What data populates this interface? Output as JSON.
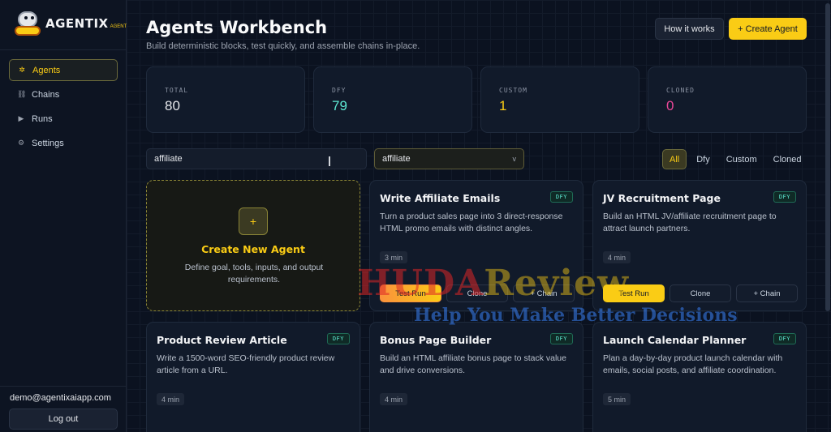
{
  "sidebar": {
    "logo_text": "AGENTIX",
    "logo_sub": "AGENTS",
    "items": [
      {
        "label": "Agents",
        "icon": "✲"
      },
      {
        "label": "Chains",
        "icon": "⛓"
      },
      {
        "label": "Runs",
        "icon": "▶"
      },
      {
        "label": "Settings",
        "icon": "⚙"
      }
    ],
    "email": "demo@agentixaiapp.com",
    "logout": "Log out"
  },
  "header": {
    "title": "Agents Workbench",
    "subtitle": "Build deterministic blocks, test quickly, and assemble chains in-place.",
    "how_label": "How it works",
    "create_label": "+ Create Agent"
  },
  "stats": [
    {
      "label": "TOTAL",
      "value": "80",
      "color": "#e5e7eb"
    },
    {
      "label": "DFY",
      "value": "79",
      "color": "#5eead4"
    },
    {
      "label": "CUSTOM",
      "value": "1",
      "color": "#facc15"
    },
    {
      "label": "CLONED",
      "value": "0",
      "color": "#ec4899"
    }
  ],
  "search": {
    "value": "affiliate"
  },
  "category_select": {
    "value": "affiliate",
    "caret": "v"
  },
  "filters": [
    "All",
    "Dfy",
    "Custom",
    "Cloned"
  ],
  "create_card": {
    "plus": "+",
    "title": "Create New Agent",
    "desc": "Define goal, tools, inputs, and output requirements."
  },
  "cards": [
    {
      "title": "Write Affiliate Emails",
      "badge": "DFY",
      "desc": "Turn a product sales page into 3 direct-response HTML promo emails with distinct angles.",
      "time": "3 min",
      "test": "Test Run",
      "clone": "Clone",
      "chain": "+ Chain"
    },
    {
      "title": "JV Recruitment Page",
      "badge": "DFY",
      "desc": "Build an HTML JV/affiliate recruitment page to attract launch partners.",
      "time": "4 min",
      "test": "Test Run",
      "clone": "Clone",
      "chain": "+ Chain"
    },
    {
      "title": "Product Review Article",
      "badge": "DFY",
      "desc": "Write a 1500-word SEO-friendly product review article from a URL.",
      "time": "4 min"
    },
    {
      "title": "Bonus Page Builder",
      "badge": "DFY",
      "desc": "Build an HTML affiliate bonus page to stack value and drive conversions.",
      "time": "4 min"
    },
    {
      "title": "Launch Calendar Planner",
      "badge": "DFY",
      "desc": "Plan a day-by-day product launch calendar with emails, social posts, and affiliate coordination.",
      "time": "5 min"
    }
  ],
  "watermark": {
    "main_a": "HUDA",
    "main_b": "Review",
    "sub": "Help You Make Better Decisions"
  }
}
